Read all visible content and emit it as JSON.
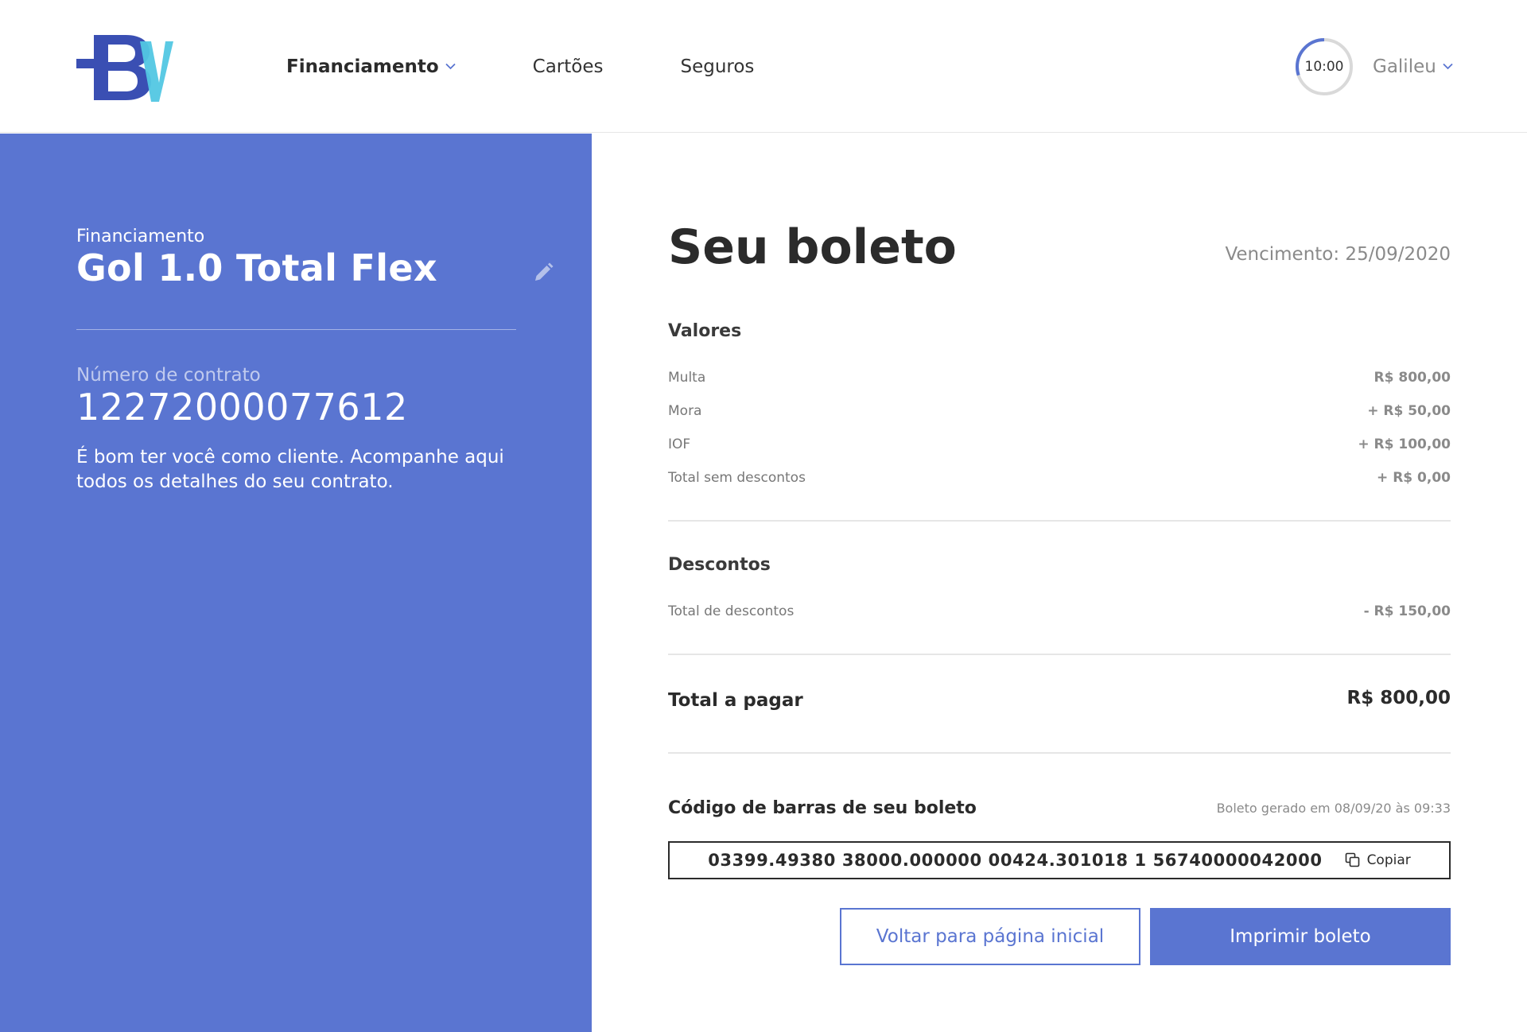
{
  "header": {
    "nav": [
      {
        "label": "Financiamento",
        "active": true,
        "has_dropdown": true
      },
      {
        "label": "Cartões",
        "active": false,
        "has_dropdown": false
      },
      {
        "label": "Seguros",
        "active": false,
        "has_dropdown": false
      }
    ],
    "timer": {
      "label": "10:00",
      "progress": 0.3
    },
    "user": {
      "name": "Galileu"
    }
  },
  "sidebar": {
    "category": "Financiamento",
    "vehicle": "Gol 1.0 Total Flex",
    "contract_label": "Número de contrato",
    "contract_number": "12272000077612",
    "welcome": "É bom ter você como cliente. Acompanhe aqui todos os detalhes do seu contrato."
  },
  "main": {
    "title": "Seu boleto",
    "due_date": "Vencimento: 25/09/2020",
    "valores": {
      "title": "Valores",
      "rows": [
        {
          "label": "Multa",
          "value": "R$ 800,00"
        },
        {
          "label": "Mora",
          "value": "+ R$ 50,00"
        },
        {
          "label": "IOF",
          "value": "+ R$ 100,00"
        },
        {
          "label": "Total sem descontos",
          "value": "+ R$ 0,00"
        }
      ]
    },
    "descontos": {
      "title": "Descontos",
      "rows": [
        {
          "label": "Total de descontos",
          "value": "- R$ 150,00"
        }
      ]
    },
    "total": {
      "label": "Total a pagar",
      "value": "R$ 800,00"
    },
    "barcode": {
      "title": "Código de barras de seu boleto",
      "generated": "Boleto gerado em 08/09/20 às 09:33",
      "code": "03399.49380 38000.000000 00424.301018 1 56740000042000",
      "copy_label": "Copiar"
    },
    "buttons": {
      "back": "Voltar para página inicial",
      "print": "Imprimir boleto"
    }
  },
  "colors": {
    "brand": "#5a75d1",
    "logo_dark": "#3a4fb3",
    "logo_light": "#52c7e3",
    "text": "#2b2b2b",
    "muted": "#8a8a8a"
  }
}
